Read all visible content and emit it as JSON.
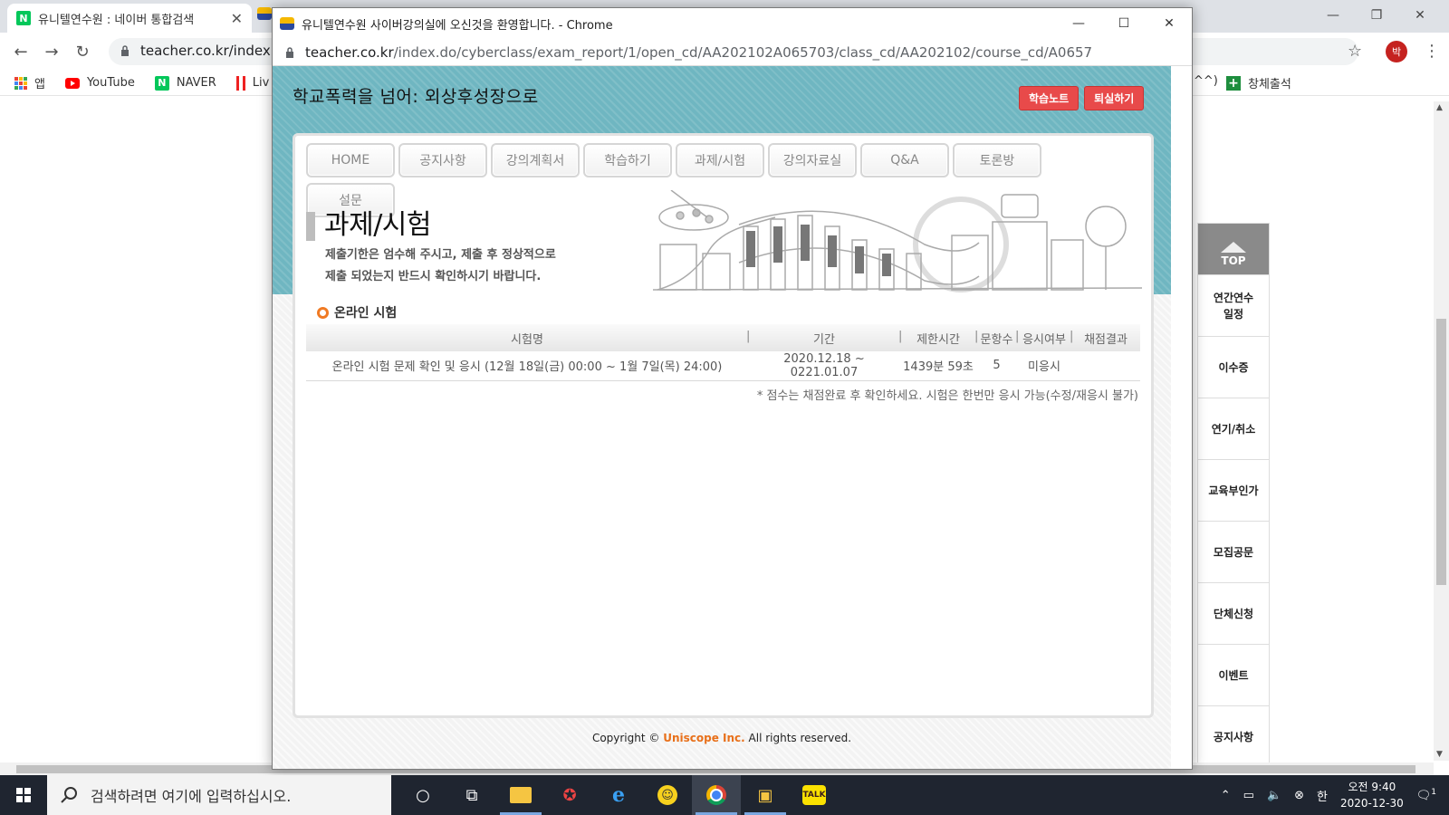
{
  "bg_browser": {
    "tab_title": "유니텔연수원 : 네이버 통합검색",
    "url": "teacher.co.kr/index.d",
    "profile_initial": "박",
    "bookmarks": [
      {
        "label": "앱",
        "icon": "apps-icon"
      },
      {
        "label": "YouTube",
        "icon": "youtube-icon"
      },
      {
        "label": "NAVER",
        "icon": "naver-icon"
      },
      {
        "label": "Liv",
        "icon": "live-icon"
      }
    ],
    "bookmark_right_text": "^^)",
    "bookmark_right_label": "창체출석"
  },
  "quick_menu": {
    "top_label": "TOP",
    "items": [
      "연간연수\n일정",
      "이수증",
      "연기/취소",
      "교육부인가",
      "모집공문",
      "단체신청",
      "이벤트",
      "공지사항"
    ]
  },
  "popup": {
    "window_title": "유니텔연수원 사이버강의실에 오신것을 환영합니다. - Chrome",
    "url_host": "teacher.co.kr",
    "url_path": "/index.do/cyberclass/exam_report/1/open_cd/AA202102A065703/class_cd/AA202102/course_cd/A0657",
    "course_title": "학교폭력을 넘어: 외상후성장으로",
    "btn_note": "학습노트",
    "btn_exit": "퇴실하기",
    "menu": [
      "HOME",
      "공지사항",
      "강의계획서",
      "학습하기",
      "과제/시험",
      "강의자료실",
      "Q&A",
      "토론방",
      "설문"
    ],
    "section_title": "과제/시험",
    "section_desc_1": "제출기한은 엄수해 주시고, 제출 후 정상적으로",
    "section_desc_2": "제출 되었는지 반드시 확인하시기 바랍니다.",
    "sub_title": "온라인 시험",
    "table": {
      "headers": [
        "시험명",
        "기간",
        "제한시간",
        "문항수",
        "응시여부",
        "채점결과"
      ],
      "rows": [
        [
          "온라인 시험 문제 확인 및 응시 (12월 18일(금) 00:00 ~ 1월 7일(목) 24:00)",
          "2020.12.18 ~ 0221.01.07",
          "1439분 59초",
          "5",
          "미응시",
          ""
        ]
      ]
    },
    "note": "* 점수는 채점완료 후 확인하세요. 시험은 한번만 응시 가능(수정/재응시 불가)",
    "copyright_pre": "Copyright ©",
    "copyright_brand": "Uniscope Inc.",
    "copyright_post": "All rights reserved."
  },
  "taskbar": {
    "search_placeholder": "검색하려면 여기에 입력하십시오.",
    "kakao_label": "TALK",
    "ime": "한",
    "time": "오전 9:40",
    "date": "2020-12-30",
    "notification_count": "1"
  },
  "colors": {
    "teal_band": "#6fb6c1",
    "red_button": "#e84a4a",
    "brand_orange": "#e8701a",
    "taskbar": "#1f2530"
  }
}
